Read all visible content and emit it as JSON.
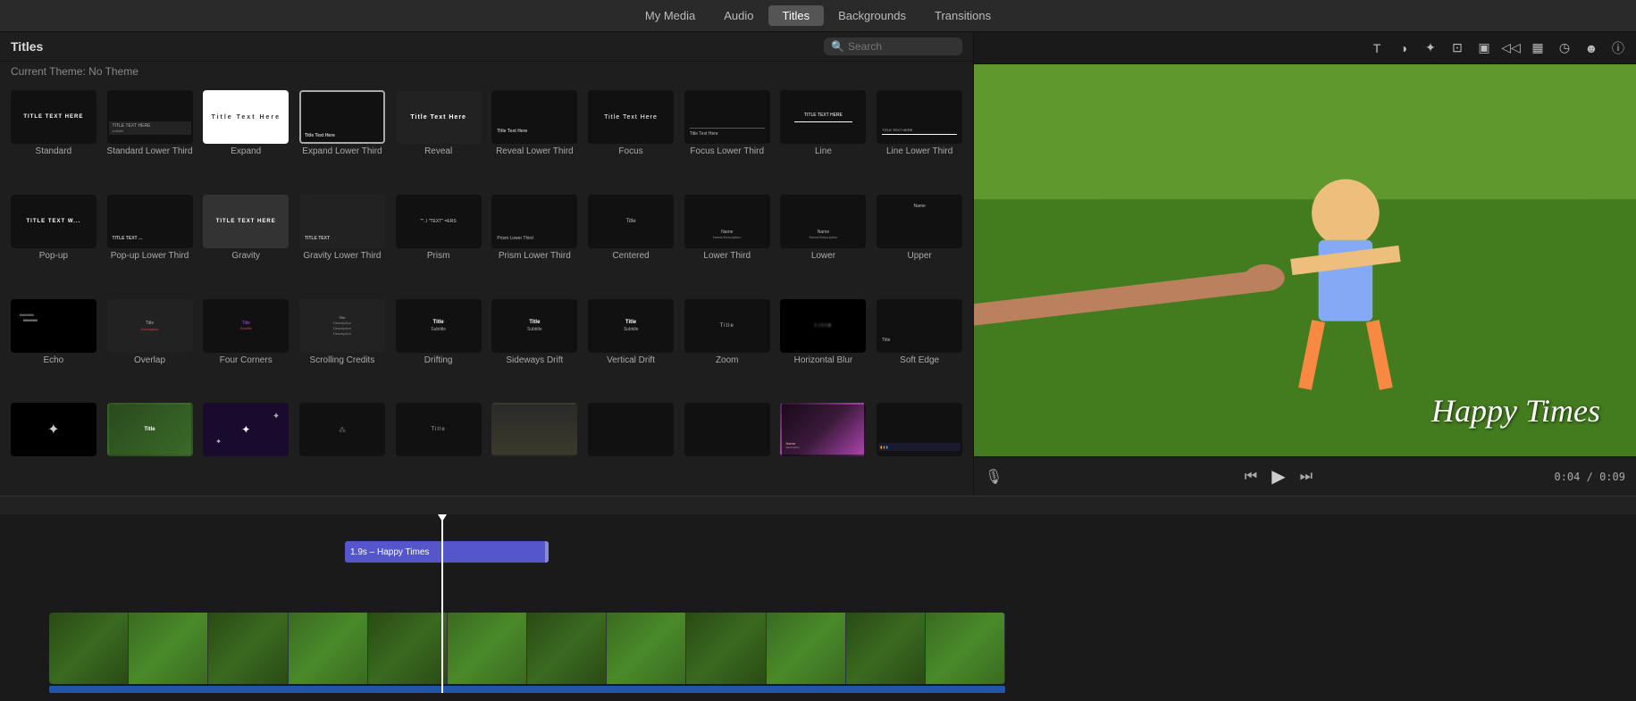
{
  "nav": {
    "items": [
      {
        "label": "My Media",
        "id": "my-media",
        "active": false
      },
      {
        "label": "Audio",
        "id": "audio",
        "active": false
      },
      {
        "label": "Titles",
        "id": "titles",
        "active": true
      },
      {
        "label": "Backgrounds",
        "id": "backgrounds",
        "active": false
      },
      {
        "label": "Transitions",
        "id": "transitions",
        "active": false
      }
    ]
  },
  "left_panel": {
    "title": "Titles",
    "theme_label": "Current Theme: No Theme",
    "search_placeholder": "Search"
  },
  "titles": [
    {
      "id": "standard",
      "label": "Standard",
      "row": 0
    },
    {
      "id": "standard-lower-third",
      "label": "Standard Lower Third",
      "row": 0
    },
    {
      "id": "expand",
      "label": "Expand",
      "row": 0
    },
    {
      "id": "expand-lower-third",
      "label": "Expand Lower Third",
      "row": 0,
      "selected": true
    },
    {
      "id": "reveal",
      "label": "Reveal",
      "row": 0
    },
    {
      "id": "reveal-lower-third",
      "label": "Reveal Lower Third",
      "row": 0
    },
    {
      "id": "focus",
      "label": "Focus",
      "row": 0
    },
    {
      "id": "focus-lower-third",
      "label": "Focus Lower Third",
      "row": 0
    },
    {
      "id": "line",
      "label": "Line",
      "row": 0
    },
    {
      "id": "line-lower-third",
      "label": "Line Lower Third",
      "row": 0
    },
    {
      "id": "popup",
      "label": "Pop-up",
      "row": 1
    },
    {
      "id": "popup-lower-third",
      "label": "Pop-up Lower Third",
      "row": 1
    },
    {
      "id": "gravity",
      "label": "Gravity",
      "row": 1
    },
    {
      "id": "gravity-lower-third",
      "label": "Gravity Lower Third",
      "row": 1
    },
    {
      "id": "prism",
      "label": "Prism",
      "row": 1
    },
    {
      "id": "prism-lower-third",
      "label": "Prism Lower Third",
      "row": 1
    },
    {
      "id": "centered",
      "label": "Centered",
      "row": 1
    },
    {
      "id": "lower-third",
      "label": "Lower Third",
      "row": 1
    },
    {
      "id": "lower",
      "label": "Lower",
      "row": 1
    },
    {
      "id": "upper",
      "label": "Upper",
      "row": 1
    },
    {
      "id": "echo",
      "label": "Echo",
      "row": 2
    },
    {
      "id": "overlap",
      "label": "Overlap",
      "row": 2
    },
    {
      "id": "four-corners",
      "label": "Four Corners",
      "row": 2
    },
    {
      "id": "scrolling-credits",
      "label": "Scrolling Credits",
      "row": 2
    },
    {
      "id": "drifting",
      "label": "Drifting",
      "row": 2
    },
    {
      "id": "sideways-drift",
      "label": "Sideways Drift",
      "row": 2
    },
    {
      "id": "vertical-drift",
      "label": "Vertical Drift",
      "row": 2
    },
    {
      "id": "zoom",
      "label": "Zoom",
      "row": 2
    },
    {
      "id": "horizontal-blur",
      "label": "Horizontal Blur",
      "row": 2
    },
    {
      "id": "soft-edge",
      "label": "Soft Edge",
      "row": 2
    },
    {
      "id": "particle1",
      "label": "",
      "row": 3
    },
    {
      "id": "particle2",
      "label": "",
      "row": 3
    },
    {
      "id": "particle3",
      "label": "",
      "row": 3
    },
    {
      "id": "particle4",
      "label": "",
      "row": 3
    },
    {
      "id": "particle5",
      "label": "",
      "row": 3
    },
    {
      "id": "particle6",
      "label": "",
      "row": 3
    },
    {
      "id": "particle7",
      "label": "",
      "row": 3
    },
    {
      "id": "particle8",
      "label": "",
      "row": 3
    },
    {
      "id": "particle9",
      "label": "",
      "row": 3
    },
    {
      "id": "particle10",
      "label": "",
      "row": 3
    }
  ],
  "toolbar_icons": [
    {
      "id": "text-icon",
      "symbol": "T"
    },
    {
      "id": "color-icon",
      "symbol": "◑"
    },
    {
      "id": "effects-icon",
      "symbol": "✦"
    },
    {
      "id": "crop-icon",
      "symbol": "⊡"
    },
    {
      "id": "camera-icon",
      "symbol": "▣"
    },
    {
      "id": "volume-icon",
      "symbol": "◁◁"
    },
    {
      "id": "bars-icon",
      "symbol": "▦"
    },
    {
      "id": "speed-icon",
      "symbol": "◷"
    },
    {
      "id": "person-icon",
      "symbol": "☻"
    },
    {
      "id": "info-icon",
      "symbol": "ⓘ"
    }
  ],
  "preview": {
    "title_text": "Happy Times"
  },
  "playback": {
    "time_current": "0:04",
    "time_total": "0:09",
    "separator": "/"
  },
  "timeline": {
    "clip_label": "1.9s – Happy Times"
  }
}
